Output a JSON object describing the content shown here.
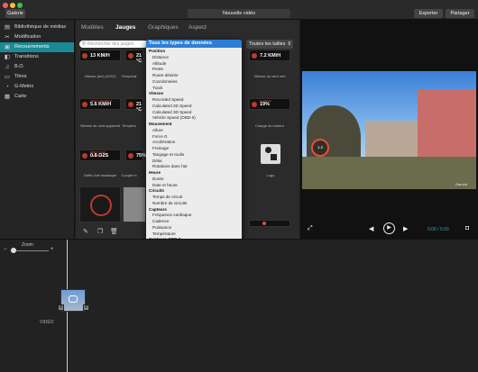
{
  "window": {
    "gallery_button": "Galerie",
    "project_title": "Nouvelle vidéo",
    "export_button": "Exporter",
    "share_button": "Partager"
  },
  "sidebar": {
    "items": [
      {
        "label": "Bibliothèque de médias",
        "icon": "film-icon"
      },
      {
        "label": "Modification",
        "icon": "scissors-icon"
      },
      {
        "label": "Recouvrements",
        "icon": "overlay-icon",
        "active": true
      },
      {
        "label": "Transitions",
        "icon": "transition-icon"
      },
      {
        "label": "B.O.",
        "icon": "music-icon"
      },
      {
        "label": "Titres",
        "icon": "title-icon"
      },
      {
        "label": "G-Metrix",
        "icon": "gauge-icon"
      },
      {
        "label": "Carte",
        "icon": "map-icon"
      }
    ]
  },
  "tabs": [
    "Modèles",
    "Jauges",
    "Graphiques",
    "Aspect"
  ],
  "active_tab": "Jauges",
  "search": {
    "placeholder": "Rechercher des jauges"
  },
  "size_select": "Toutes les tailles",
  "gauges": [
    {
      "value": "13 KM/H",
      "caption": "Vitesse (km) (SOG)"
    },
    {
      "value": "21 °C",
      "caption": "Températ"
    },
    {
      "value": "7.2 KM/H",
      "caption": "Vitesse du vent réel"
    },
    {
      "value": "5.6 KM/H",
      "tag": "VENT APPARENT",
      "caption": "Vitesse du vent apparent"
    },
    {
      "value": "21 °C",
      "caption": "Tempéra"
    },
    {
      "value": "19%",
      "tag": "CHARGE",
      "caption": "Charge du moteur"
    },
    {
      "value": "0.8 O2S",
      "tag": "DÉBIT D'AIR MASSIQUE",
      "caption": "Débit d'air massique"
    },
    {
      "value": "75%",
      "caption": "Couple m"
    },
    {
      "caption": "Logo"
    }
  ],
  "dropdown": {
    "selected": "Tous les types de données",
    "rows": [
      {
        "t": "Position",
        "h": true
      },
      {
        "t": "Distance"
      },
      {
        "t": "Altitude"
      },
      {
        "t": "Pente"
      },
      {
        "t": "Route désirée"
      },
      {
        "t": "Coordonnées"
      },
      {
        "t": "Track"
      },
      {
        "t": "Vitesse",
        "h": true
      },
      {
        "t": "Recorded Speed"
      },
      {
        "t": "Calculated 2D Speed"
      },
      {
        "t": "Calculated 3D Speed"
      },
      {
        "t": "Vehicle Speed (OBD-II)"
      },
      {
        "t": "Mouvement",
        "h": true
      },
      {
        "t": "Allure"
      },
      {
        "t": "Force G"
      },
      {
        "t": "Accélération"
      },
      {
        "t": "Freinage"
      },
      {
        "t": "Tangage et roulis"
      },
      {
        "t": "Délai"
      },
      {
        "t": "Rotations dans l'air"
      },
      {
        "t": "Heure",
        "h": true
      },
      {
        "t": "Durée"
      },
      {
        "t": "Date et heure"
      },
      {
        "t": "Circuits",
        "h": true
      },
      {
        "t": "Temps de circuit"
      },
      {
        "t": "Nombre de circuits"
      },
      {
        "t": "Capteurs",
        "h": true
      },
      {
        "t": "Fréquence cardiaque"
      },
      {
        "t": "Cadence"
      },
      {
        "t": "Puissance"
      },
      {
        "t": "Température"
      },
      {
        "t": "Capteurs OBD-II",
        "h": true
      },
      {
        "t": "Charge du moteur"
      },
      {
        "t": "Température du liquide de refroidissement"
      },
      {
        "t": "Régime du moteur"
      },
      {
        "t": "Vitesse du véhicule"
      },
      {
        "t": "Température de l'admission"
      },
      {
        "t": "Débit d'air massique"
      },
      {
        "t": "Position de l'accélérateur"
      },
      {
        "t": "Débit de carburant du moteur"
      },
      {
        "t": "Couple moteur"
      },
      {
        "t": "Course à pied",
        "h": true
      },
      {
        "t": "Oscillation verticale"
      },
      {
        "t": "Durée du contact avec le sol"
      },
      {
        "t": "Pourcentage du contact avec le sol"
      },
      {
        "t": "Marine",
        "h": true
      },
      {
        "t": "Aviation",
        "h": true
      },
      {
        "t": "Logo",
        "h": true
      }
    ]
  },
  "preview": {
    "overlay_value": "1.2",
    "watermark": "Garmin",
    "time": "0:00 / 0:00"
  },
  "timeline": {
    "zoom_label": "Zoom",
    "track_label": "VIDÉO"
  },
  "colors": {
    "accent": "#1b8a95",
    "selection": "#2c7ed6",
    "gauge_red": "#c0392b"
  }
}
